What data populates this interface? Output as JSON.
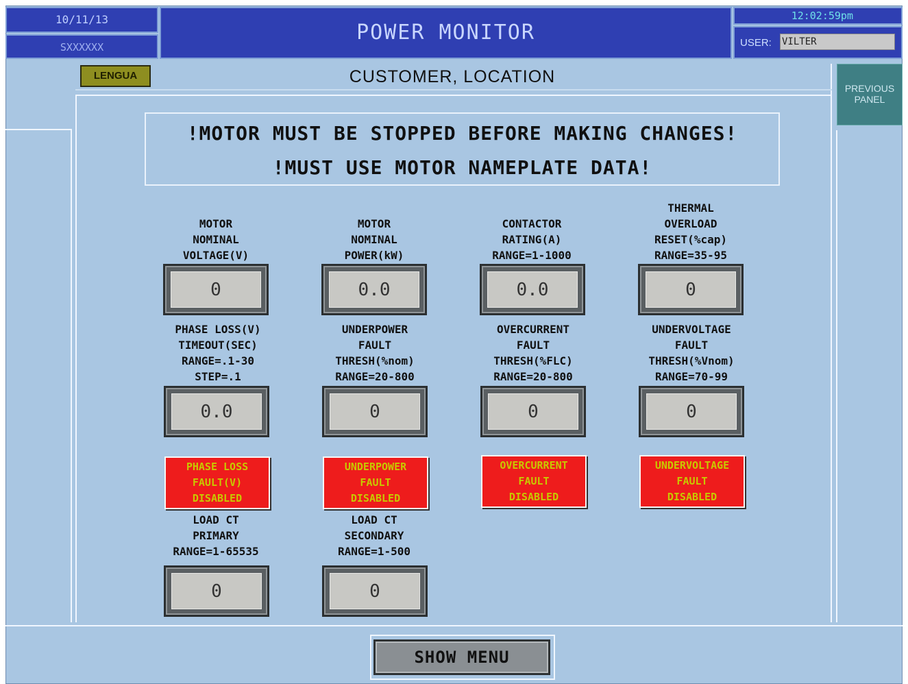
{
  "header": {
    "date": "10/11/13",
    "serial": "SXXXXXX",
    "title": "POWER MONITOR",
    "time": "12:02:59pm",
    "user_label": "USER:",
    "user_value": "VILTER"
  },
  "toolbar": {
    "lengua_label": "LENGUA",
    "location_title": "CUSTOMER, LOCATION",
    "previous_panel_line1": "PREVIOUS",
    "previous_panel_line2": "PANEL"
  },
  "warning": {
    "line1": "!MOTOR MUST BE STOPPED BEFORE MAKING CHANGES!",
    "line2": "!MUST USE MOTOR NAMEPLATE DATA!"
  },
  "params": [
    {
      "label": [
        "MOTOR",
        "NOMINAL",
        "VOLTAGE(V)"
      ],
      "value": "0"
    },
    {
      "label": [
        "MOTOR",
        "NOMINAL",
        "POWER(kW)"
      ],
      "value": "0.0"
    },
    {
      "label": [
        "CONTACTOR",
        "RATING(A)",
        "RANGE=1-1000"
      ],
      "value": "0.0"
    },
    {
      "label": [
        "THERMAL",
        "OVERLOAD",
        "RESET(%cap)",
        "RANGE=35-95"
      ],
      "value": "0"
    },
    {
      "label": [
        "PHASE LOSS(V)",
        "TIMEOUT(SEC)",
        "RANGE=.1-30",
        "STEP=.1"
      ],
      "value": "0.0"
    },
    {
      "label": [
        "UNDERPOWER",
        "FAULT",
        "THRESH(%nom)",
        "RANGE=20-800"
      ],
      "value": "0"
    },
    {
      "label": [
        "OVERCURRENT",
        "FAULT",
        "THRESH(%FLC)",
        "RANGE=20-800"
      ],
      "value": "0"
    },
    {
      "label": [
        "UNDERVOLTAGE",
        "FAULT",
        "THRESH(%Vnom)",
        "RANGE=70-99"
      ],
      "value": "0"
    },
    {
      "label": [
        "LOAD CT",
        "PRIMARY",
        "RANGE=1-65535"
      ],
      "value": "0"
    },
    {
      "label": [
        "LOAD CT",
        "SECONDARY",
        "RANGE=1-500"
      ],
      "value": "0"
    }
  ],
  "faults": [
    [
      "PHASE LOSS",
      "FAULT(V)",
      "DISABLED"
    ],
    [
      "UNDERPOWER",
      "FAULT",
      "DISABLED"
    ],
    [
      "OVERCURRENT",
      "FAULT",
      "DISABLED"
    ],
    [
      "UNDERVOLTAGE",
      "FAULT",
      "DISABLED"
    ]
  ],
  "footer": {
    "show_menu_label": "SHOW MENU"
  },
  "colors": {
    "background": "#a9c6e2",
    "header": "#2f3fb2",
    "fault": "#ee1c1c",
    "lengua": "#8e8e20",
    "previous_panel": "#3f7f84"
  }
}
